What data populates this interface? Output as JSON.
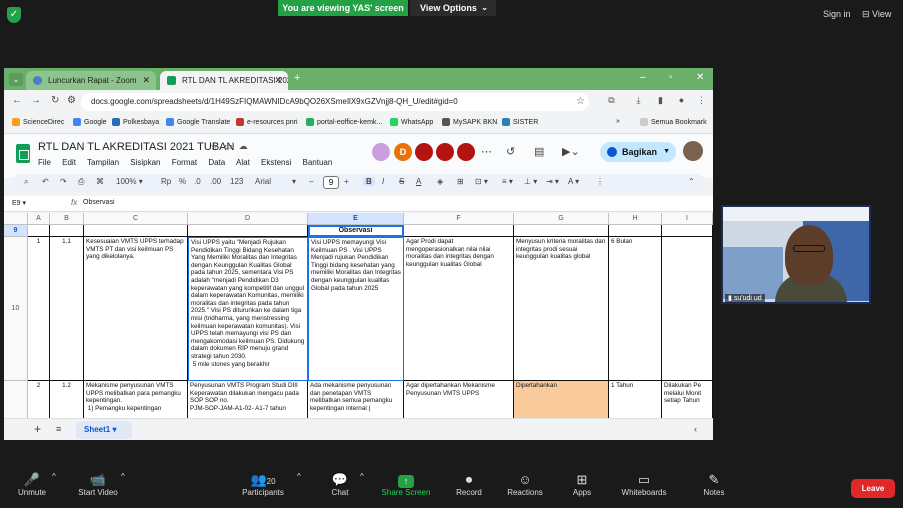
{
  "zoom_top": {
    "banner": "You are viewing YAS' screen",
    "view_options": "View Options",
    "sign_in": "Sign in",
    "view": "View"
  },
  "browser": {
    "tabs": [
      {
        "label": "Luncurkan Rapat - Zoom"
      },
      {
        "label": "RTL DAN TL AKREDITASI 2021"
      }
    ],
    "url": "docs.google.com/spreadsheets/d/1H49SzFIQMAWNIDcA9bQO26XSmeIlX9xGZVnjj8-QH_U/edit#gid=0",
    "bookmarks": [
      {
        "label": "ScienceDirec",
        "color": "#f4a21d"
      },
      {
        "label": "Google",
        "color": "#4285f4"
      },
      {
        "label": "Polkesbaya",
        "color": "#2a6bb3"
      },
      {
        "label": "Google Translate",
        "color": "#4285f4"
      },
      {
        "label": "e-resources pnri",
        "color": "#c0392b"
      },
      {
        "label": "portal-eoffice-kemk...",
        "color": "#27ae60"
      },
      {
        "label": "WhatsApp",
        "color": "#25d366"
      },
      {
        "label": "MySAPK BKN",
        "color": "#555555"
      },
      {
        "label": "SISTER",
        "color": "#2980b9"
      }
    ],
    "all_bookmarks": "Semua Bookmark"
  },
  "sheets": {
    "title": "RTL DAN TL AKREDITASI 2021 TUBAN",
    "menus": [
      "File",
      "Edit",
      "Tampilan",
      "Sisipkan",
      "Format",
      "Data",
      "Alat",
      "Ekstensi",
      "Bantuan"
    ],
    "avatars": [
      {
        "letter": "",
        "color": "#c9a0dc"
      },
      {
        "letter": "D",
        "color": "#e8710a"
      },
      {
        "letter": "",
        "color": "#b31412"
      },
      {
        "letter": "",
        "color": "#b31412"
      },
      {
        "letter": "",
        "color": "#b31412"
      }
    ],
    "share_label": "Bagikan",
    "toolbar": {
      "zoom": "100%",
      "currency": "Rp",
      "percent": "%",
      "dec_less": ".0",
      "dec_more": ".00",
      "num_format": "123",
      "font": "Arial",
      "font_size": "9"
    },
    "cell_ref": "E9",
    "formula": "Observasi",
    "columns": [
      "A",
      "B",
      "C",
      "D",
      "E",
      "F",
      "G",
      "H",
      "I"
    ],
    "rows": [
      {
        "num": "9",
        "cells": [
          "",
          "",
          "",
          "",
          "Observasi",
          "",
          "",
          "",
          ""
        ]
      },
      {
        "num": "10",
        "cells": [
          "1",
          "1.1",
          "Kesesuaian VMTS UPPS terhadap VMTS PT dan visi keilmuan PS yang dikelolanya.",
          "Visi UPPS yaitu \"Menjadi Rujukan Pendidikan Tinggi Bidang Kesehatan Yang Memiliki Moralitas dan Integritas dengan Keunggulan Kualitas Global pada tahun 2025, sementara Visi PS adalah \"menjadi Pendidikan D3 keperawatan yang kompetitif dan unggul dalam keperawatan Komunitas, memiliki moralitas dan integritas pada tahun 2025.\" Visi PS diturunkan ke dalam tiga misi (tridharma, yang menstressing keilmuan keperawatan komunitas). Visi UPPS telah memayungi visi PS dan mengakomodasi keilmuan PS. Didukung dalam dokumen RIP menuju grand strategi tahun 2030.\n 5 mile stones yang berakhir",
          "Visi UPPS memayungi Visi Keilmuan PS . Visi UPPS Menjadi rujukan Pendidikan Tinggi bidang kesehatan yang memiliki Moralitas dan Integritas dengan keunggulan kualitas Global pada tahun 2025",
          "Agar Prodi dapat mengoperasionalkan nilai nilai moralitas dan integritas dengan keunggulan kualitas Global",
          "Menyusun kriteria moralitas dan integritas prodi sesuai keunggulan kualitas global",
          "6 Bulan",
          ""
        ]
      },
      {
        "num": "",
        "cells": [
          "2",
          "1.2",
          "Mekanisme penyusunan VMTS UPPS melibatkan para pemangku kepentingan.\n 1) Pemangku kepentingan",
          "Penyusunan VMTS Program Studi DIII Keperawatan dilakukan mengacu pada SOP SOP no.\nPJM-SOP-JAM-A1-02- A1-7 tahun",
          "Ada mekanisme penyusunan dan penetapan VMTS melibatkan semua pemangku kepentingan internal (",
          "Agar dipertahankan Mekanisme Penyusunan VMTS UPPS",
          "Dipertahankan",
          "1 Tahun",
          "Dilakukan Pe melalui Monit setiap Tahun"
        ]
      }
    ],
    "sheet_tab": "Sheet1"
  },
  "video": {
    "name": "su'udi ud"
  },
  "zoom_bottom": {
    "items": [
      {
        "label": "Unmute",
        "icon": "🎤"
      },
      {
        "label": "Start Video",
        "icon": "📹"
      },
      {
        "label": "Participants",
        "icon": "👥",
        "count": "20"
      },
      {
        "label": "Chat",
        "icon": "💬"
      },
      {
        "label": "Share Screen",
        "icon": "↑"
      },
      {
        "label": "Record",
        "icon": "⏺"
      },
      {
        "label": "Reactions",
        "icon": "☺"
      },
      {
        "label": "Apps",
        "icon": "⊞"
      },
      {
        "label": "Whiteboards",
        "icon": "▭"
      },
      {
        "label": "Notes",
        "icon": "✎"
      }
    ],
    "leave": "Leave"
  }
}
